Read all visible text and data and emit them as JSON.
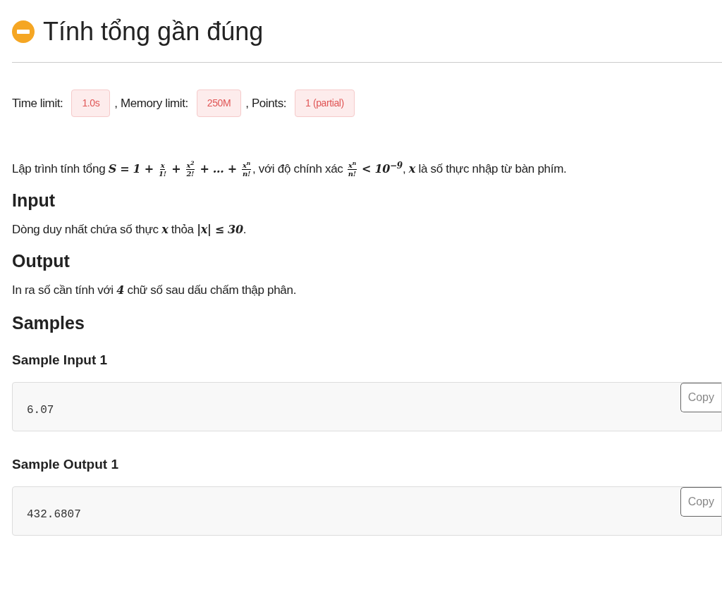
{
  "title": "Tính tổng gần đúng",
  "limits": [
    {
      "label": "Time limit:",
      "value": "1.0s"
    },
    {
      "label": ", Memory limit:",
      "value": "250M"
    },
    {
      "label": ", Points:",
      "value": "1 (partial)"
    }
  ],
  "description": [
    {
      "kind": "text",
      "text": "Lập trình tính tổng "
    },
    {
      "kind": "math",
      "text": "S = 1 + "
    },
    {
      "kind": "frac",
      "num": "x",
      "den": "1!"
    },
    {
      "kind": "math",
      "text": " + "
    },
    {
      "kind": "frac",
      "num": "x$^{2}$",
      "den": "2!"
    },
    {
      "kind": "math",
      "text": " + … + "
    },
    {
      "kind": "frac",
      "num": "x$^{n}$",
      "den": "n!"
    },
    {
      "kind": "text",
      "text": ", với độ chính xác "
    },
    {
      "kind": "frac",
      "num": "x$^{n}$",
      "den": "n!"
    },
    {
      "kind": "math",
      "text": " < 10$^{−9}$"
    },
    {
      "kind": "text",
      "text": ", "
    },
    {
      "kind": "math",
      "text": "x"
    },
    {
      "kind": "text",
      "text": " là số thực nhập từ bàn phím."
    }
  ],
  "sections": [
    {
      "heading": "Input",
      "body": [
        {
          "kind": "text",
          "text": "Dòng duy nhất chứa số thực "
        },
        {
          "kind": "math",
          "text": "x"
        },
        {
          "kind": "text",
          "text": " thỏa "
        },
        {
          "kind": "math",
          "text": "|x| ≤ 30"
        },
        {
          "kind": "text",
          "text": "."
        }
      ]
    },
    {
      "heading": "Output",
      "body": [
        {
          "kind": "text",
          "text": "In ra số cần tính với "
        },
        {
          "kind": "math",
          "text": "4"
        },
        {
          "kind": "text",
          "text": " chữ số sau dấu chấm thập phân."
        }
      ]
    }
  ],
  "samples_heading": "Samples",
  "samples": [
    {
      "heading": "Sample Input 1",
      "code": "6.07",
      "button": "Copy"
    },
    {
      "heading": "Sample Output 1",
      "code": "432.6807",
      "button": "Copy"
    }
  ]
}
